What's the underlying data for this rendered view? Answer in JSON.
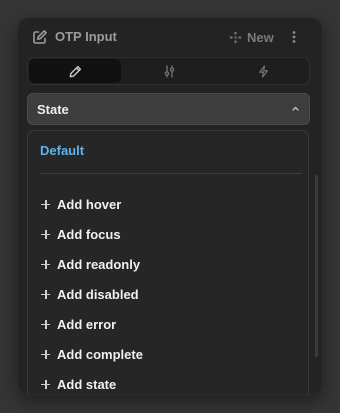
{
  "header": {
    "title": "OTP Input",
    "title_icon": "edit-square-icon",
    "new_label": "New",
    "new_icon": "move-icon",
    "more_icon": "vertical-dots-icon"
  },
  "tabs": [
    {
      "icon": "pencil-icon",
      "active": true
    },
    {
      "icon": "sliders-icon",
      "active": false
    },
    {
      "icon": "lightning-icon",
      "active": false
    }
  ],
  "state_select": {
    "label": "State",
    "icon": "chevron-up-icon"
  },
  "dropdown": {
    "default_label": "Default",
    "items": [
      {
        "label": "Add hover"
      },
      {
        "label": "Add focus"
      },
      {
        "label": "Add readonly"
      },
      {
        "label": "Add disabled"
      },
      {
        "label": "Add error"
      },
      {
        "label": "Add complete"
      },
      {
        "label": "Add state"
      }
    ]
  },
  "colors": {
    "accent": "#5fb3ee",
    "panel": "#232323",
    "background": "#353535"
  }
}
